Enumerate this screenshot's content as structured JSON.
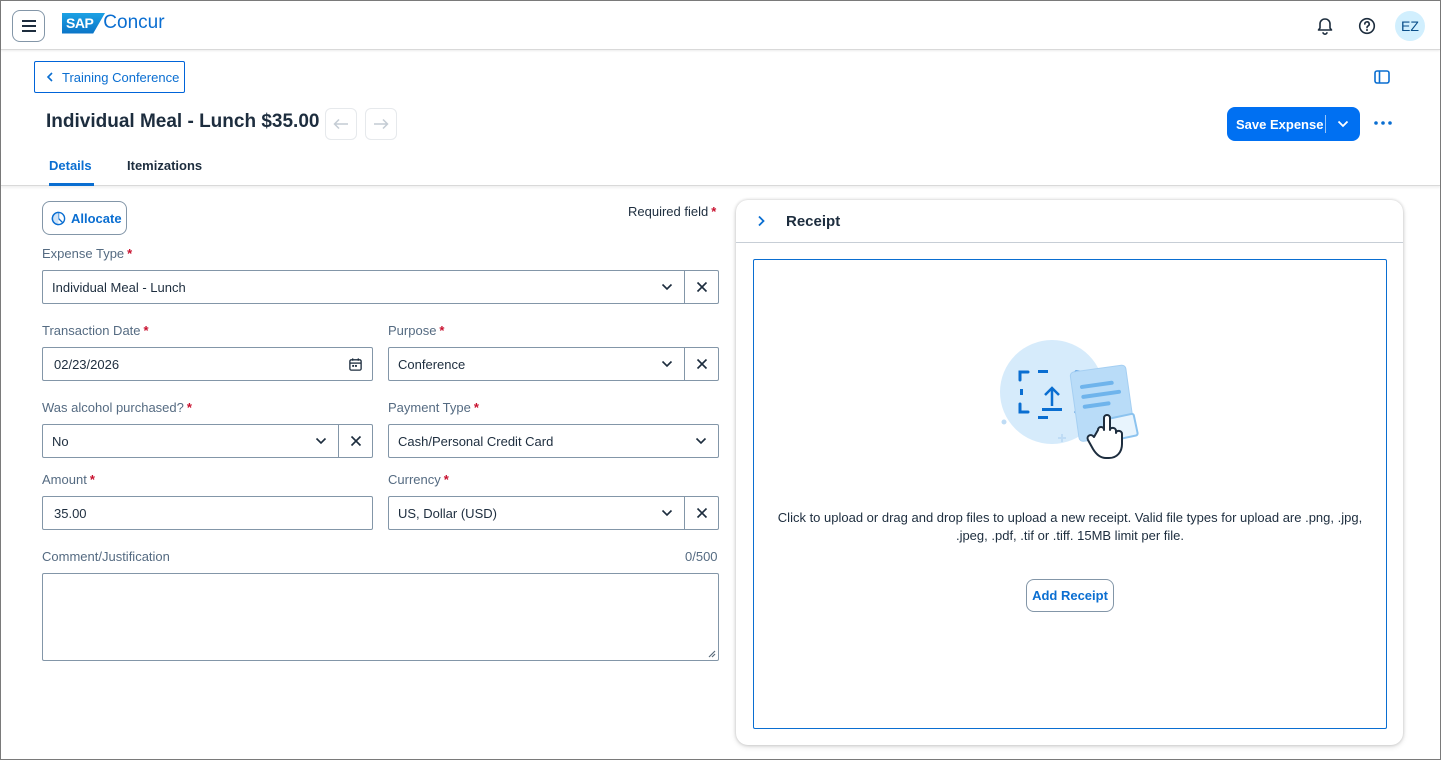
{
  "brand": {
    "sap": "SAP",
    "name": "Concur"
  },
  "header": {
    "avatar_initials": "EZ"
  },
  "back_link": {
    "label": "Training Conference"
  },
  "page": {
    "title": "Individual Meal - Lunch $35.00"
  },
  "actions": {
    "save_label": "Save Expense"
  },
  "tabs": [
    {
      "label": "Details",
      "active": true
    },
    {
      "label": "Itemizations",
      "active": false
    }
  ],
  "form": {
    "allocate_label": "Allocate",
    "required_note": "Required field",
    "required_star": "*",
    "expense_type": {
      "label": "Expense Type",
      "value": "Individual Meal - Lunch"
    },
    "transaction_date": {
      "label": "Transaction Date",
      "value": "02/23/2026"
    },
    "purpose": {
      "label": "Purpose",
      "value": "Conference"
    },
    "alcohol": {
      "label": "Was alcohol purchased?",
      "value": "No"
    },
    "payment_type": {
      "label": "Payment Type",
      "value": "Cash/Personal Credit Card"
    },
    "amount": {
      "label": "Amount",
      "value": "35.00"
    },
    "currency": {
      "label": "Currency",
      "value": "US, Dollar (USD)"
    },
    "comment": {
      "label": "Comment/Justification",
      "counter": "0/500",
      "value": ""
    }
  },
  "receipt": {
    "title": "Receipt",
    "instructions": "Click to upload or drag and drop files to upload a new receipt. Valid file types for upload are .png, .jpg, .jpeg, .pdf, .tif or .tiff. 15MB limit per file.",
    "add_label": "Add Receipt"
  },
  "colors": {
    "accent": "#0a6ed1",
    "primary_button": "#0070f2",
    "required": "#c8102e"
  }
}
